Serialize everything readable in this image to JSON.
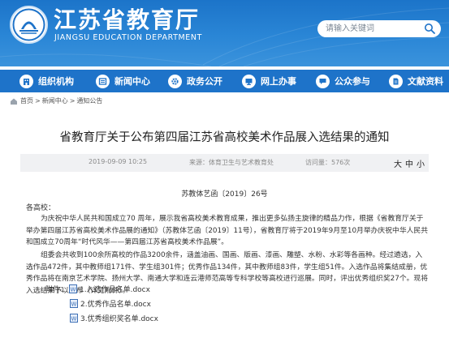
{
  "header": {
    "title": "江苏省教育厅",
    "subtitle": "JIANGSU EDUCATION DEPARTMENT",
    "search_placeholder": "请输入关键词",
    "colors": {
      "primary": "#1e73c9",
      "header_light": "#3b93dc"
    }
  },
  "nav": {
    "items": [
      {
        "label": "组织机构",
        "icon": "building-icon"
      },
      {
        "label": "新闻中心",
        "icon": "news-icon"
      },
      {
        "label": "政务公开",
        "icon": "gear-icon"
      },
      {
        "label": "网上办事",
        "icon": "monitor-icon"
      },
      {
        "label": "公众参与",
        "icon": "chat-icon"
      },
      {
        "label": "文献资料",
        "icon": "document-icon"
      }
    ]
  },
  "breadcrumb": {
    "icon": "home-icon",
    "items": [
      "首页",
      "新闻中心",
      "通知公告"
    ],
    "separator": ">"
  },
  "article": {
    "title": "省教育厅关于公布第四届江苏省高校美术作品展入选结果的通知",
    "meta": {
      "date": "2019-09-09 10:25",
      "source": "来源：体育卫生与艺术教育处",
      "views": "访问量：576次",
      "font_label": "大",
      "font_sizes": [
        "中",
        "小"
      ]
    },
    "doc_number": "苏教体艺函〔2019〕26号",
    "salutation": "各高校：",
    "paragraph1": "为庆祝中华人民共和国成立70 周年，展示我省高校美术教育成果，推出更多弘扬主旋律的精品力作，根据《省教育厅关于举办第四届江苏省高校美术作品展的通知》（苏教体艺函〔2019〕11号），省教育厅将于2019年9月至10月举办庆祝中华人民共和国成立70周年“时代风华——第四届江苏省高校美术作品展”。",
    "paragraph2": "组委会共收到100余所高校的作品3200余件，涵盖油画、国画、版画、漆画、雕塑、水粉、水彩等各画种。经过遴选，入选作品472件，其中教师组171件、学生组301件；优秀作品134件，其中教师组83件，学生组51件。入选作品将集结成册，优秀作品将在南京艺术学院、扬州大学、南通大学和连云港师范高等专科学校等高校进行巡展。同时，评出优秀组织奖27个。现将入选结果予以公布（详见附件）。",
    "attachments_label": "附件：",
    "attachments": [
      "1.入选作品名单.docx",
      "2.优秀作品名单.docx",
      "3.优秀组织奖名单.docx"
    ]
  }
}
